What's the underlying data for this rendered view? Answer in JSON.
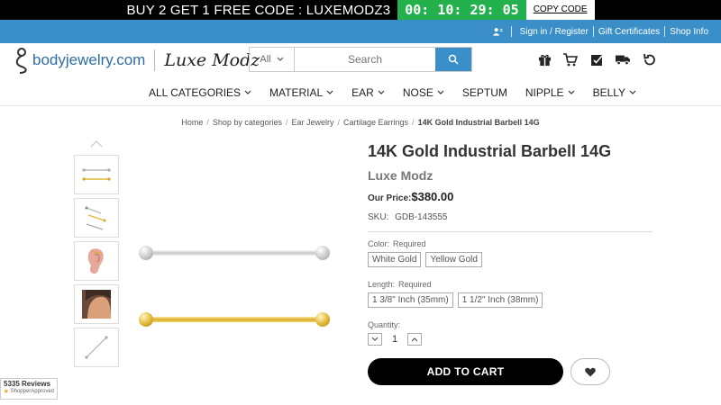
{
  "promo": {
    "text": "BUY 2 GET 1 FREE CODE : LUXEMODZ3",
    "timer": "00: 10: 29: 05",
    "copy_label": "COPY CODE"
  },
  "util": {
    "sign_in": "Sign in / Register",
    "gift": "Gift Certificates",
    "shop_info": "Shop Info"
  },
  "header": {
    "logo_text": "bodyjewelry.com",
    "logo_luxe": "Luxe Modz",
    "search_category": "All",
    "search_placeholder": "Search"
  },
  "nav": [
    {
      "label": "ALL CATEGORIES",
      "dropdown": true
    },
    {
      "label": "MATERIAL",
      "dropdown": true
    },
    {
      "label": "EAR",
      "dropdown": true
    },
    {
      "label": "NOSE",
      "dropdown": true
    },
    {
      "label": "SEPTUM",
      "dropdown": false
    },
    {
      "label": "NIPPLE",
      "dropdown": true
    },
    {
      "label": "BELLY",
      "dropdown": true
    }
  ],
  "breadcrumb": [
    "Home",
    "Shop by categories",
    "Ear Jewelry",
    "Cartilage Earrings",
    "14K Gold Industrial Barbell 14G"
  ],
  "product": {
    "title": "14K Gold Industrial Barbell 14G",
    "brand": "Luxe Modz",
    "price_label": "Our Price:",
    "price": "$380.00",
    "sku_label": "SKU:",
    "sku": "GDB-143555",
    "color_label": "Color:",
    "color_required": "Required",
    "colors": [
      "White Gold",
      "Yellow Gold"
    ],
    "length_label": "Length:",
    "length_required": "Required",
    "lengths": [
      "1 3/8\" Inch (35mm)",
      "1 1/2\" Inch (38mm)"
    ],
    "quantity_label": "Quantity:",
    "quantity": "1",
    "add_to_cart": "ADD TO CART"
  },
  "reviews": {
    "count": "5335 Reviews",
    "badge": "ShopperApproved"
  },
  "colors": {
    "promo_timer": "#22b14c",
    "accent": "#3b8fc9"
  }
}
